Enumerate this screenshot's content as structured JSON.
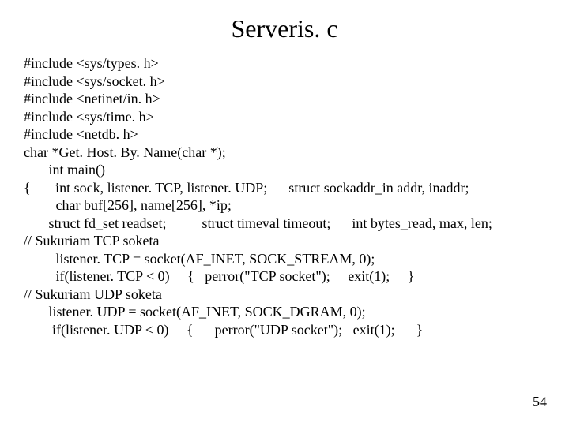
{
  "title": "Serveris. c",
  "lines": [
    "#include <sys/types. h>",
    "#include <sys/socket. h>",
    "#include <netinet/in. h>",
    "#include <sys/time. h>",
    "#include <netdb. h>",
    "char *Get. Host. By. Name(char *);",
    "       int main()",
    "{       int sock, listener. TCP, listener. UDP;      struct sockaddr_in addr, inaddr;",
    "         char buf[256], name[256], *ip;",
    "       struct fd_set readset;          struct timeval timeout;      int bytes_read, max, len;",
    "// Sukuriam TCP soketa",
    "         listener. TCP = socket(AF_INET, SOCK_STREAM, 0);",
    "         if(listener. TCP < 0)     {   perror(\"TCP socket\");     exit(1);     }",
    "// Sukuriam UDP soketa",
    "       listener. UDP = socket(AF_INET, SOCK_DGRAM, 0);",
    "        if(listener. UDP < 0)     {      perror(\"UDP socket\");   exit(1);      }"
  ],
  "page_number": "54"
}
